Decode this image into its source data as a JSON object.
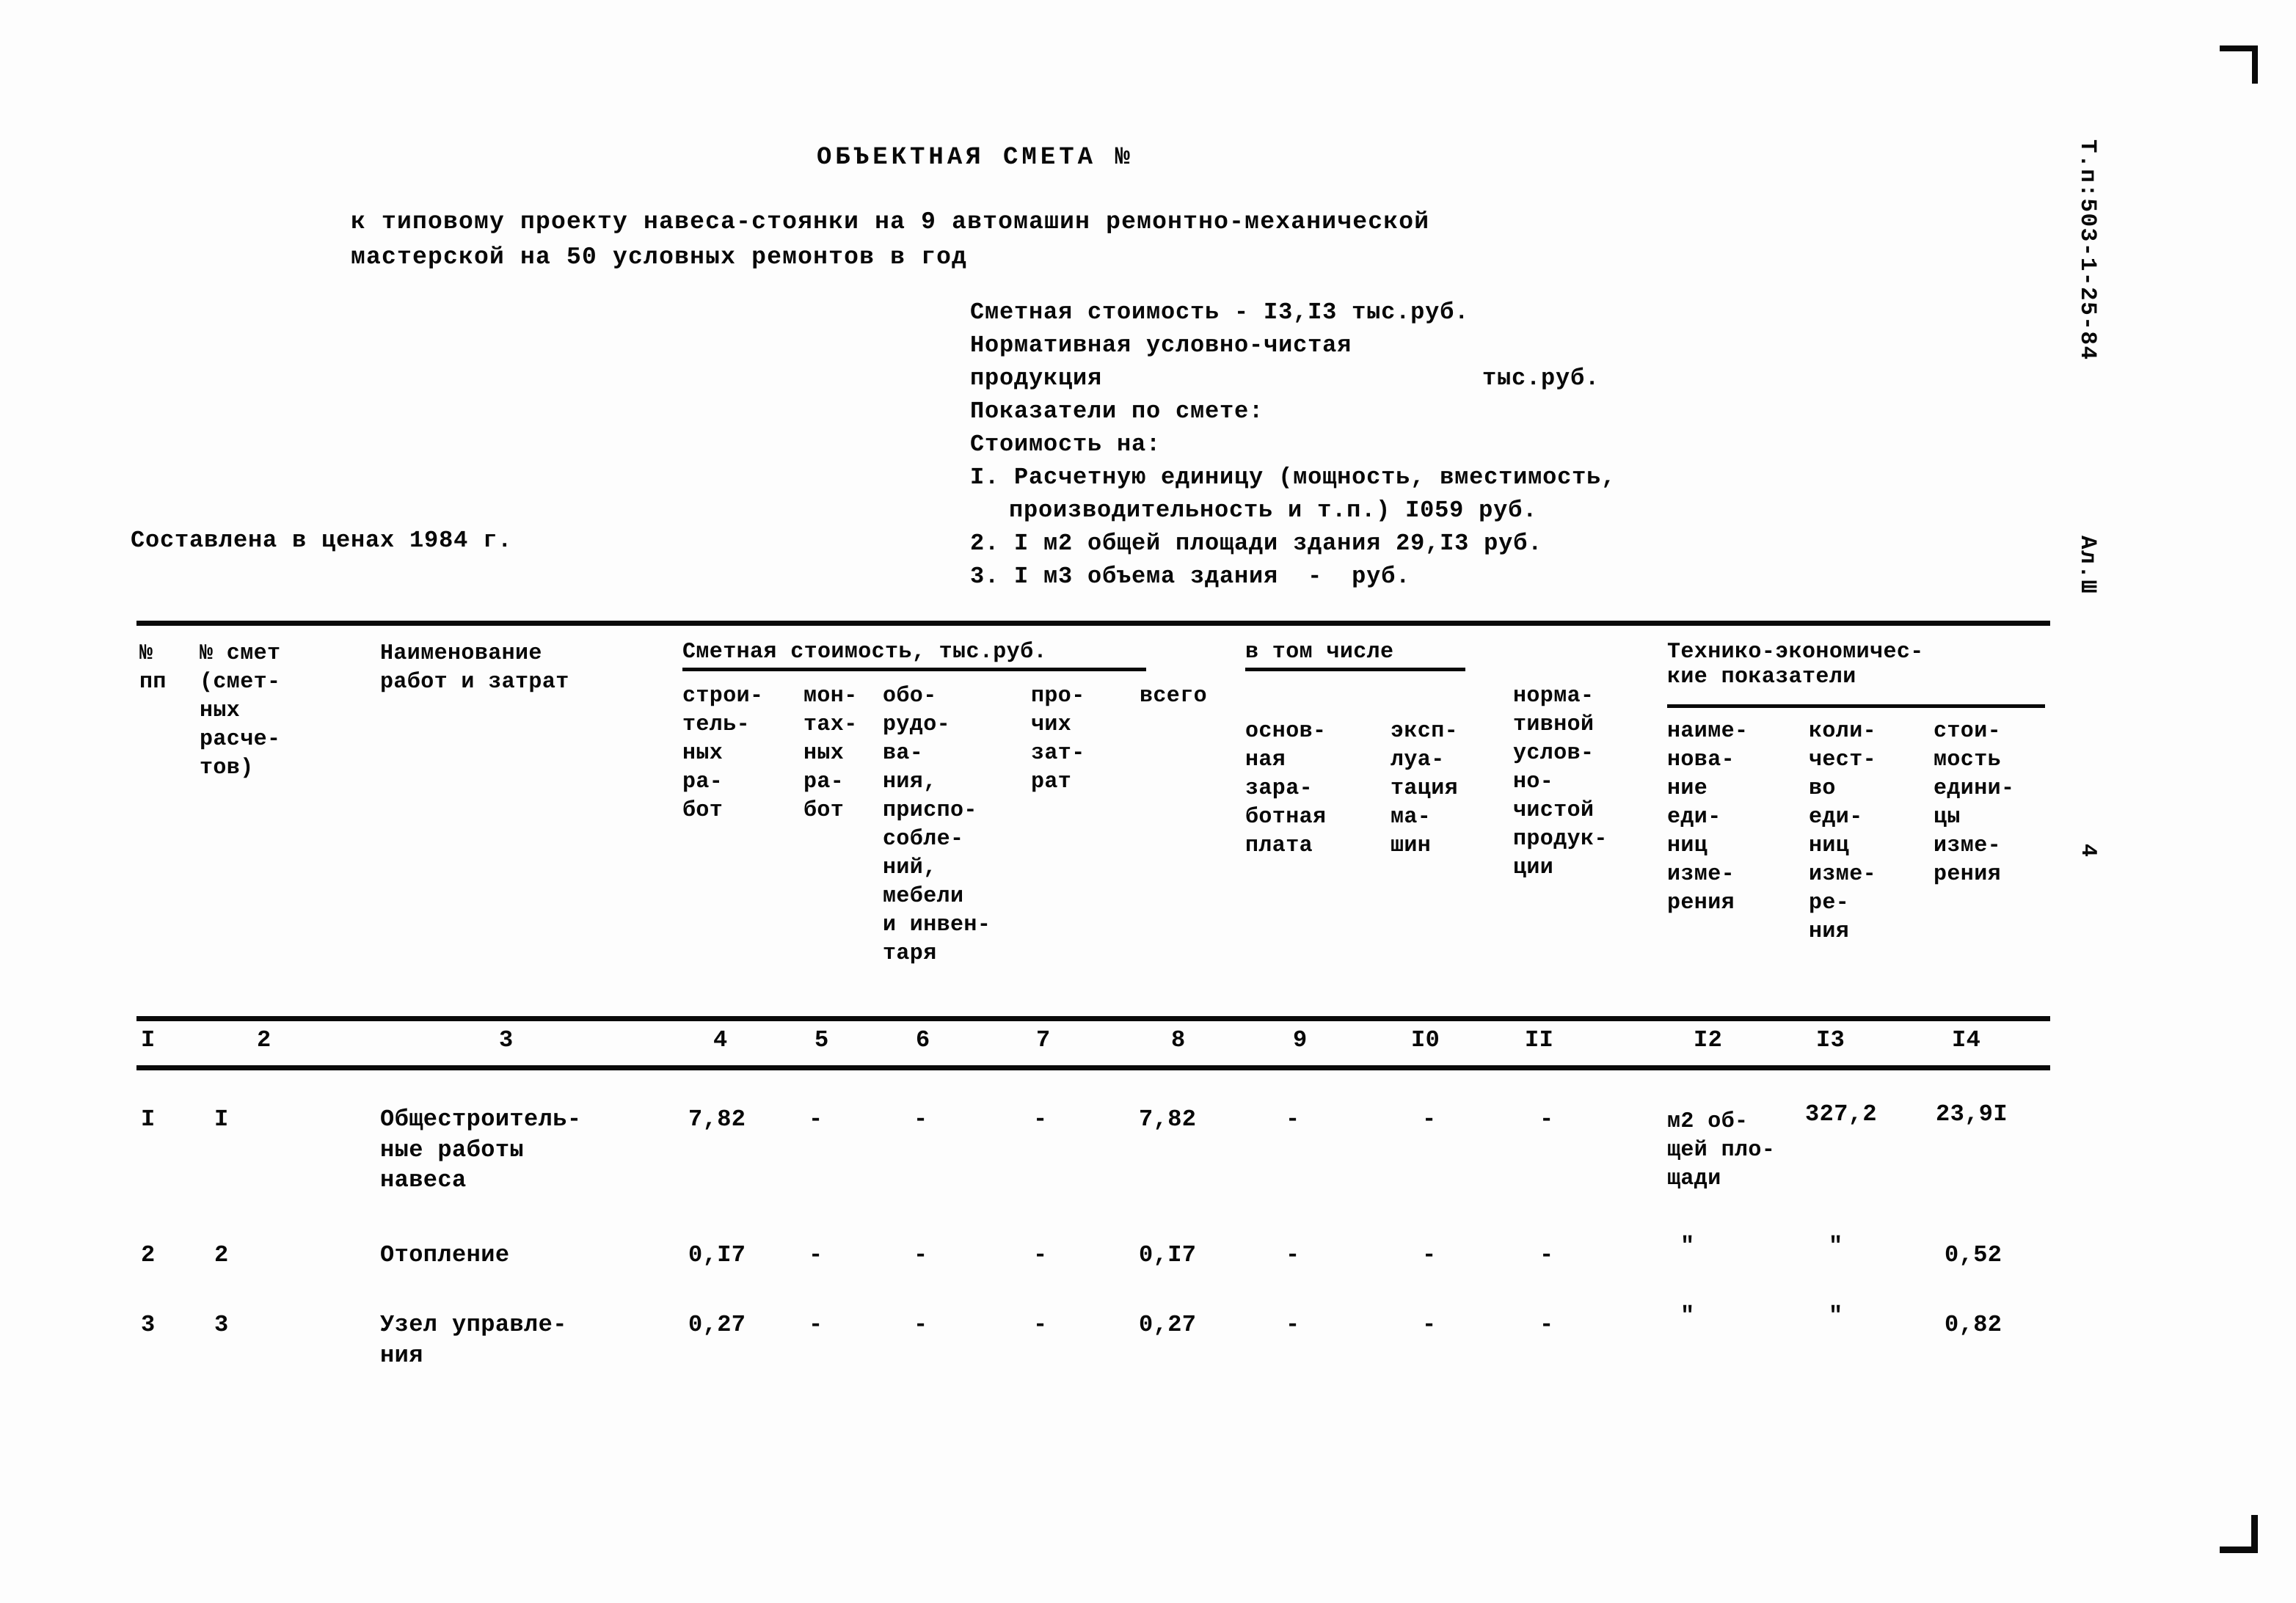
{
  "document": {
    "title": "ОБЪЕКТНАЯ СМЕТА №",
    "subtitle_line1": "к типовому проекту навеса-стоянки на 9 автомашин ремонтно-механической",
    "subtitle_line2": "мастерской на 50 условных ремонтов в год",
    "prices_note": "Составлена в ценах 1984 г."
  },
  "summary": {
    "line1": "Сметная стоимость - I3,I3 тыс.руб.",
    "line2": "Нормативная условно-чистая",
    "line3_label": "продукция",
    "line3_units": "тыс.руб.",
    "line4": "Показатели по смете:",
    "line5": "Стоимость на:",
    "item1_a": "I. Расчетную единицу (мощность, вместимость,",
    "item1_b": "производительность и т.п.) I059 руб.",
    "item2": "2. I м2 общей площади здания 29,I3 руб.",
    "item3": "3. I м3 объема здания  -  руб."
  },
  "table": {
    "headers": {
      "col1": "№\nпп",
      "col2": "№ смет\n(смет-\nных\nрасче-\nтов)",
      "col3": "Наименование\nработ и затрат",
      "group_cost": "Сметная стоимость, тыс.руб.",
      "col4": "строи-\nтель-\nных\nра-\nбот",
      "col5": "мон-\nтах-\nных\nра-\nбот",
      "col6": "обо-\nрудо-\nва-\nния,\nприспо-\nсобле-\nний,\nмебели\nи инвен-\nтаря",
      "col7": "про-\nчих\nзат-\nрат",
      "col8": "всего",
      "group_including": "в том числе",
      "col9": "основ-\nная\nзара-\nботная\nплата",
      "col10": "эксп-\nлуа-\nтация\nма-\nшин",
      "col11": "норма-\nтивной\nуслов-\nно-\nчистой\nпродук-\nции",
      "group_tech": "Технико-экономичес-\nкие показатели",
      "col12": "наиме-\nнова-\nние\nеди-\nниц\nизме-\nрения",
      "col13": "коли-\nчест-\nво\nеди-\nниц\nизме-\nре-\nния",
      "col14": "стои-\nмость\nедини-\nцы\nизме-\nрения"
    },
    "column_numbers": [
      "I",
      "2",
      "3",
      "4",
      "5",
      "6",
      "7",
      "8",
      "9",
      "I0",
      "II",
      "I2",
      "I3",
      "I4"
    ],
    "rows": [
      {
        "c1": "I",
        "c2": "I",
        "c3": "Общестроитель-\nные работы\nнавеса",
        "c4": "7,82",
        "c5": "-",
        "c6": "-",
        "c7": "-",
        "c8": "7,82",
        "c9": "-",
        "c10": "-",
        "c11": "-",
        "c12": "м2 об-\nщей пло-\nщади",
        "c13": "327,2",
        "c14": "23,9I"
      },
      {
        "c1": "2",
        "c2": "2",
        "c3": "Отопление",
        "c4": "0,I7",
        "c5": "-",
        "c6": "-",
        "c7": "-",
        "c8": "0,I7",
        "c9": "-",
        "c10": "-",
        "c11": "-",
        "c12": "\"",
        "c13": "\"",
        "c14": "0,52"
      },
      {
        "c1": "3",
        "c2": "3",
        "c3": "Узел управле-\nния",
        "c4": "0,27",
        "c5": "-",
        "c6": "-",
        "c7": "-",
        "c8": "0,27",
        "c9": "-",
        "c10": "-",
        "c11": "-",
        "c12": "\"",
        "c13": "\"",
        "c14": "0,82"
      }
    ]
  },
  "margin": {
    "project_code": "Т.п:503-1-25-84",
    "album": "Ал.Ш",
    "page_number": "4"
  }
}
